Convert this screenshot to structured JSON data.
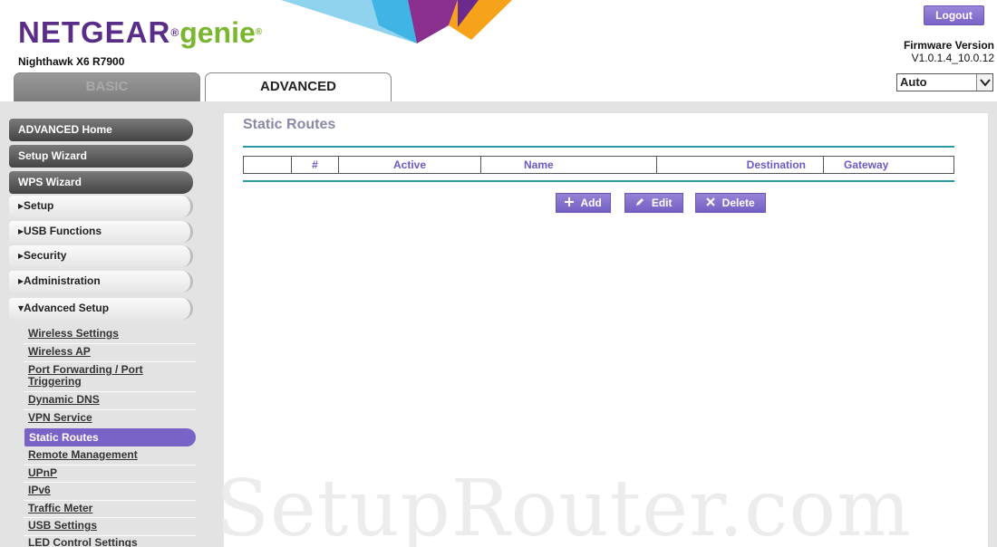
{
  "header": {
    "brand": "NETGEAR",
    "reg": "®",
    "genie": "genie",
    "genie_reg": "®",
    "model": "Nighthawk X6 R7900",
    "logout_label": "Logout",
    "firmware_title": "Firmware Version",
    "firmware_value": "V1.0.1.4_10.0.12",
    "language_value": "Auto",
    "tabs": [
      {
        "label": "BASIC",
        "active": false
      },
      {
        "label": "ADVANCED",
        "active": true
      }
    ]
  },
  "sidebar": {
    "buttons": [
      "ADVANCED Home",
      "Setup Wizard",
      "WPS Wizard"
    ],
    "menus": [
      "▸Setup",
      "▸USB Functions",
      "▸Security",
      "▸Administration",
      "▾Advanced Setup"
    ],
    "sub_items": [
      "Wireless Settings",
      "Wireless AP",
      "Port Forwarding / Port",
      "Triggering",
      "Dynamic DNS",
      "VPN Service",
      "Static Routes",
      "Remote Management",
      "UPnP",
      "IPv6",
      "Traffic Meter",
      "USB Settings",
      "LED Control Settings"
    ],
    "active_item": "Static Routes"
  },
  "main": {
    "title": "Static Routes",
    "columns": [
      "",
      "#",
      "Active",
      "Name",
      "Destination",
      "Gateway"
    ],
    "buttons": {
      "add": "Add",
      "edit": "Edit",
      "delete": "Delete"
    }
  },
  "watermark": "SetupRouter.com",
  "colors": {
    "accent_purple": "#7a63c6",
    "brand_purple": "#5a2e88",
    "genie_green": "#7ab630",
    "rule_teal": "#2b9aa8"
  },
  "icons": {
    "add": "plus-icon",
    "edit": "pencil-icon",
    "delete": "x-icon",
    "dropdown": "chevron-down-icon"
  }
}
